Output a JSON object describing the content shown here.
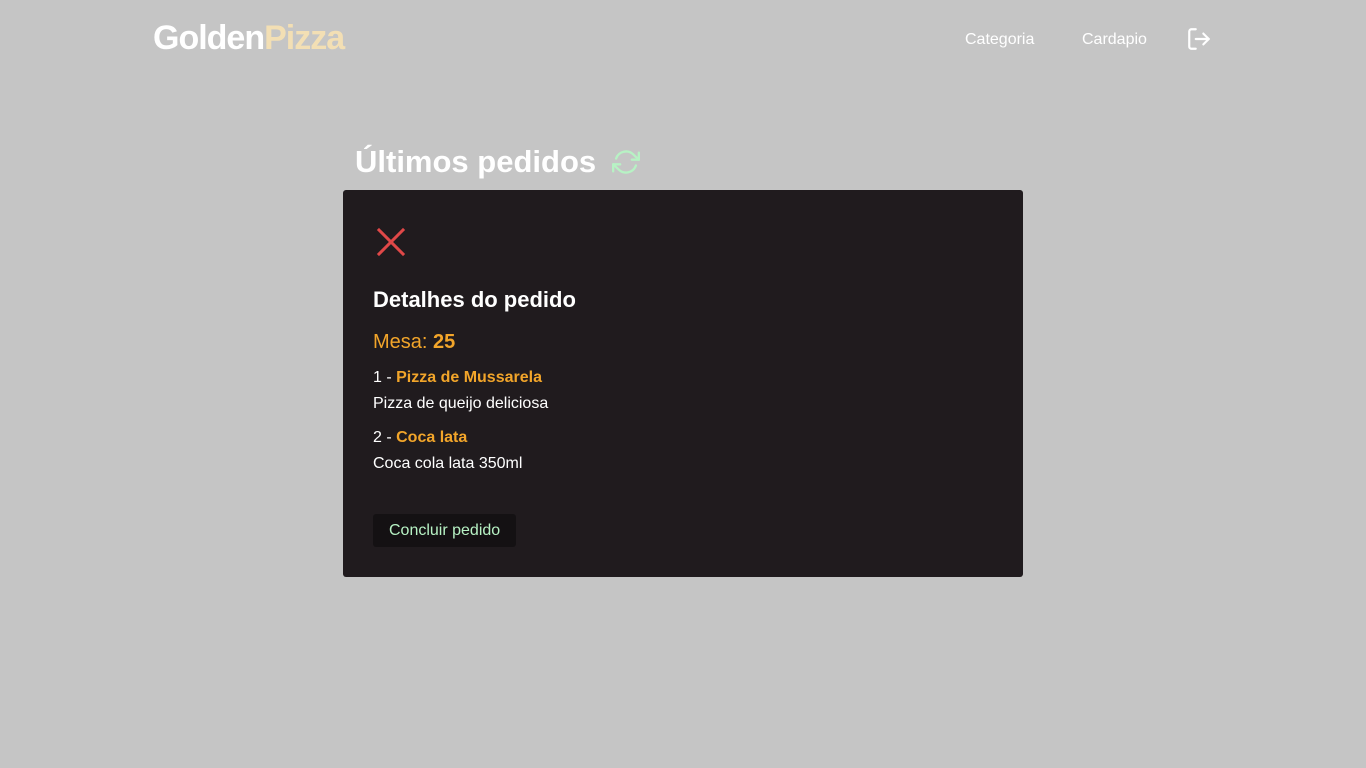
{
  "header": {
    "logo_part1": "Golden",
    "logo_part2": "Pizza",
    "nav": {
      "categoria": "Categoria",
      "cardapio": "Cardapio"
    },
    "logout_icon": "logout-icon"
  },
  "main": {
    "title": "Últimos pedidos",
    "refresh_icon": "refresh-icon"
  },
  "modal": {
    "close_icon": "close-icon",
    "title": "Detalhes do pedido",
    "table_label": "Mesa: ",
    "table_number": "25",
    "items": [
      {
        "amount": "1",
        "separator": " - ",
        "name": "Pizza de Mussarela",
        "description": "Pizza de queijo deliciosa"
      },
      {
        "amount": "2",
        "separator": " - ",
        "name": "Coca lata",
        "description": "Coca cola lata 350ml"
      }
    ],
    "conclude_label": "Concluir pedido"
  },
  "colors": {
    "background": "#c5c5c5",
    "modal_background": "#201b1e",
    "accent_orange": "#f2a52a",
    "logo_pizza": "#f3dfb4",
    "close_red": "#e04848",
    "refresh_green": "#b7f2c4",
    "button_text": "#b7f2c4"
  }
}
